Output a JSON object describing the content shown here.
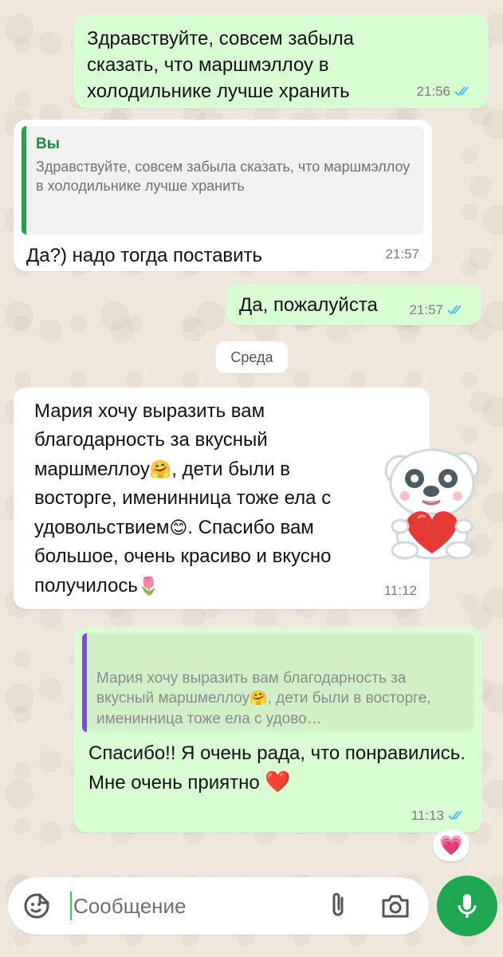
{
  "messages": [
    {
      "direction": "out",
      "text": "Здравствуйте,  совсем забыла сказать, что маршмэллоу в холодильнике лучше хранить",
      "time": "21:56",
      "status": "read"
    },
    {
      "direction": "in",
      "quote": {
        "author": "Вы",
        "text": "Здравствуйте,  совсем забыла сказать, что маршмэллоу в холодильнике лучше хранить"
      },
      "text": "Да?) надо тогда поставить",
      "time": "21:57"
    },
    {
      "direction": "out",
      "text": "Да, пожалуйста",
      "time": "21:57",
      "status": "read"
    },
    {
      "direction": "in",
      "text_parts": [
        "Мария хочу выразить вам благодарность за вкусный маршмеллоу",
        "🤗",
        ", дети были в восторге, именинница тоже ела с удовольствием",
        "😊",
        ". Спасибо вам большое, очень красиво и вкусно получилось",
        "🌷"
      ],
      "time": "11:12",
      "sticker": "bear-with-heart-sticker"
    },
    {
      "direction": "out",
      "quote": {
        "text_parts": [
          "Мария хочу выразить вам благодарность за вкусный маршмеллоу",
          "🤗",
          ", дети были в восторге, именинница тоже ела с удово…"
        ]
      },
      "text_parts": [
        "Спасибо!! Я очень рада, что понравились. Мне очень приятно ",
        "❤️"
      ],
      "time": "11:13",
      "status": "read",
      "reaction": "💗"
    }
  ],
  "date_separator": "Среда",
  "composer": {
    "placeholder": "Сообщение",
    "icons": [
      "sticker-icon",
      "attach-icon",
      "camera-icon",
      "mic-icon"
    ]
  },
  "colors": {
    "outgoing_bubble": "#d9fdd3",
    "incoming_bubble": "#ffffff",
    "read_ticks": "#53bdeb",
    "accent_green": "#1da851",
    "quote_bar_green": "#25a244",
    "quote_bar_purple": "#7d4fd6"
  }
}
